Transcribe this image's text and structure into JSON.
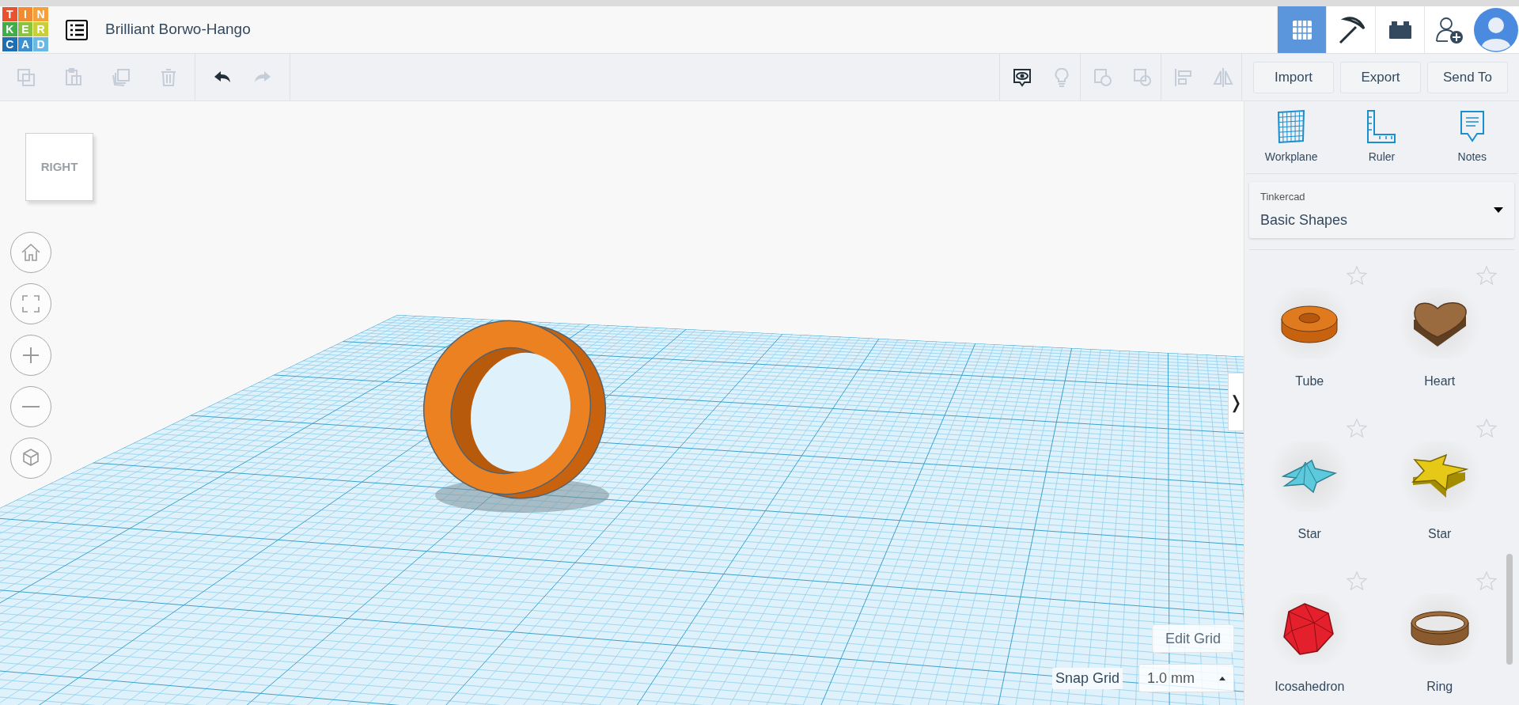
{
  "logo": {
    "letters": [
      {
        "char": "T",
        "color": "#e8532e"
      },
      {
        "char": "I",
        "color": "#f28b30"
      },
      {
        "char": "N",
        "color": "#f4a03c"
      },
      {
        "char": "K",
        "color": "#3fae49"
      },
      {
        "char": "E",
        "color": "#8ac43f"
      },
      {
        "char": "R",
        "color": "#c9cf3a"
      },
      {
        "char": "C",
        "color": "#1d6fb3"
      },
      {
        "char": "A",
        "color": "#3a90d0"
      },
      {
        "char": "D",
        "color": "#6cb8e3"
      }
    ]
  },
  "title": "Brilliant Borwo-Hango",
  "header_views": [
    {
      "kind": "grid",
      "selected": true
    },
    {
      "kind": "pickaxe",
      "selected": false
    },
    {
      "kind": "brick",
      "selected": false
    }
  ],
  "edit_tools": [
    {
      "kind": "copy",
      "disabled": true
    },
    {
      "kind": "paste",
      "disabled": true
    },
    {
      "kind": "duplicate",
      "disabled": true
    },
    {
      "kind": "delete",
      "disabled": true
    }
  ],
  "history_tools": [
    {
      "kind": "undo",
      "disabled": false
    },
    {
      "kind": "redo",
      "disabled": true
    }
  ],
  "shape_tools": [
    {
      "kind": "notes-toggle",
      "disabled": false
    },
    {
      "kind": "bulb",
      "disabled": true
    },
    {
      "kind": "group",
      "disabled": true
    },
    {
      "kind": "ungroup",
      "disabled": true
    },
    {
      "kind": "align",
      "disabled": true
    },
    {
      "kind": "mirror",
      "disabled": true
    }
  ],
  "actions": [
    "Import",
    "Export",
    "Send To"
  ],
  "view_cube": {
    "label": "RIGHT"
  },
  "edit_grid": "Edit Grid",
  "snap_grid": {
    "label": "Snap Grid",
    "value": "1.0 mm"
  },
  "panel_toggle": "❭",
  "panel_tools": [
    {
      "kind": "workplane",
      "label": "Workplane"
    },
    {
      "kind": "ruler",
      "label": "Ruler"
    },
    {
      "kind": "notes",
      "label": "Notes"
    }
  ],
  "library": {
    "caption": "Tinkercad",
    "value": "Basic Shapes"
  },
  "shapes": [
    {
      "kind": "tube",
      "name": "Tube"
    },
    {
      "kind": "heart",
      "name": "Heart"
    },
    {
      "kind": "star-pyramid",
      "name": "Star"
    },
    {
      "kind": "star",
      "name": "Star"
    },
    {
      "kind": "icosahedron",
      "name": "Icosahedron"
    },
    {
      "kind": "ring",
      "name": "Ring"
    }
  ]
}
